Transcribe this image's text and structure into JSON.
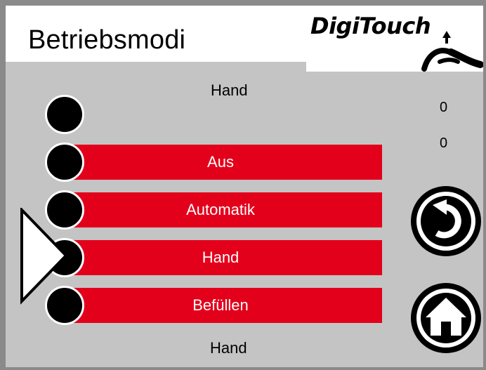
{
  "header": {
    "title": "Betriebsmodi",
    "logo_text": "DigiTouch"
  },
  "status": {
    "current_mode_top": "Hand",
    "current_mode_bottom": "Hand",
    "value1": "0",
    "value2": "0"
  },
  "modes": {
    "aus_label": "Aus",
    "automatik_label": "Automatik",
    "hand_label": "Hand",
    "befuellen_label": "Befüllen"
  },
  "selected_mode": "Hand",
  "nav": {
    "back_icon": "back-arrow-icon",
    "home_icon": "home-icon"
  },
  "colors": {
    "button_red": "#e3001b",
    "panel_gray": "#c4c4c4",
    "lamp_black": "#000000"
  }
}
